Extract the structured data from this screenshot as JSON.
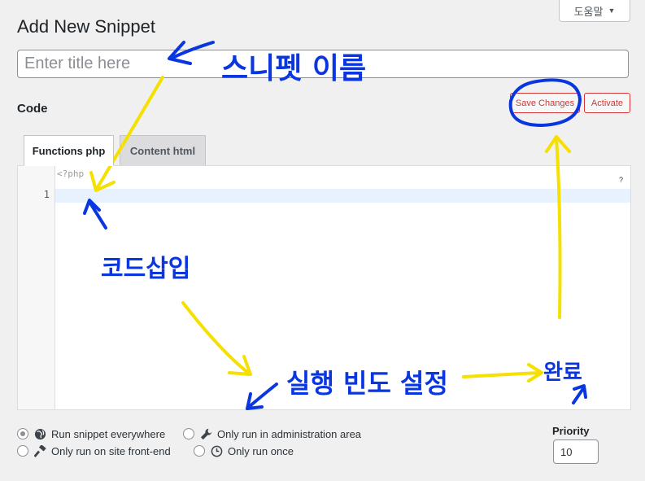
{
  "header": {
    "help_label": "도움말",
    "page_title": "Add New Snippet"
  },
  "title_field": {
    "placeholder": "Enter title here",
    "value": ""
  },
  "code_section": {
    "heading": "Code",
    "save_label": "Save Changes",
    "activate_label": "Activate"
  },
  "tabs": [
    {
      "label": "Functions php",
      "active": true
    },
    {
      "label": "Content html",
      "active": false
    }
  ],
  "editor": {
    "php_open_tag": "<?php",
    "line_number": "1",
    "hint_label": "?"
  },
  "scope_options": [
    {
      "label": "Run snippet everywhere",
      "icon": "globe-icon",
      "checked": true
    },
    {
      "label": "Only run in administration area",
      "icon": "wrench-icon",
      "checked": false
    },
    {
      "label": "Only run on site front-end",
      "icon": "hammer-icon",
      "checked": false
    },
    {
      "label": "Only run once",
      "icon": "clock-icon",
      "checked": false
    }
  ],
  "priority": {
    "label": "Priority",
    "value": "10"
  },
  "annotations": {
    "snippet_name": "스니펫 이름",
    "code_insert": "코드삽입",
    "run_frequency": "실행 빈도 설정",
    "save_note": "완료",
    "ink_blue": "#0a36e0",
    "ink_yellow": "#f5e000"
  }
}
